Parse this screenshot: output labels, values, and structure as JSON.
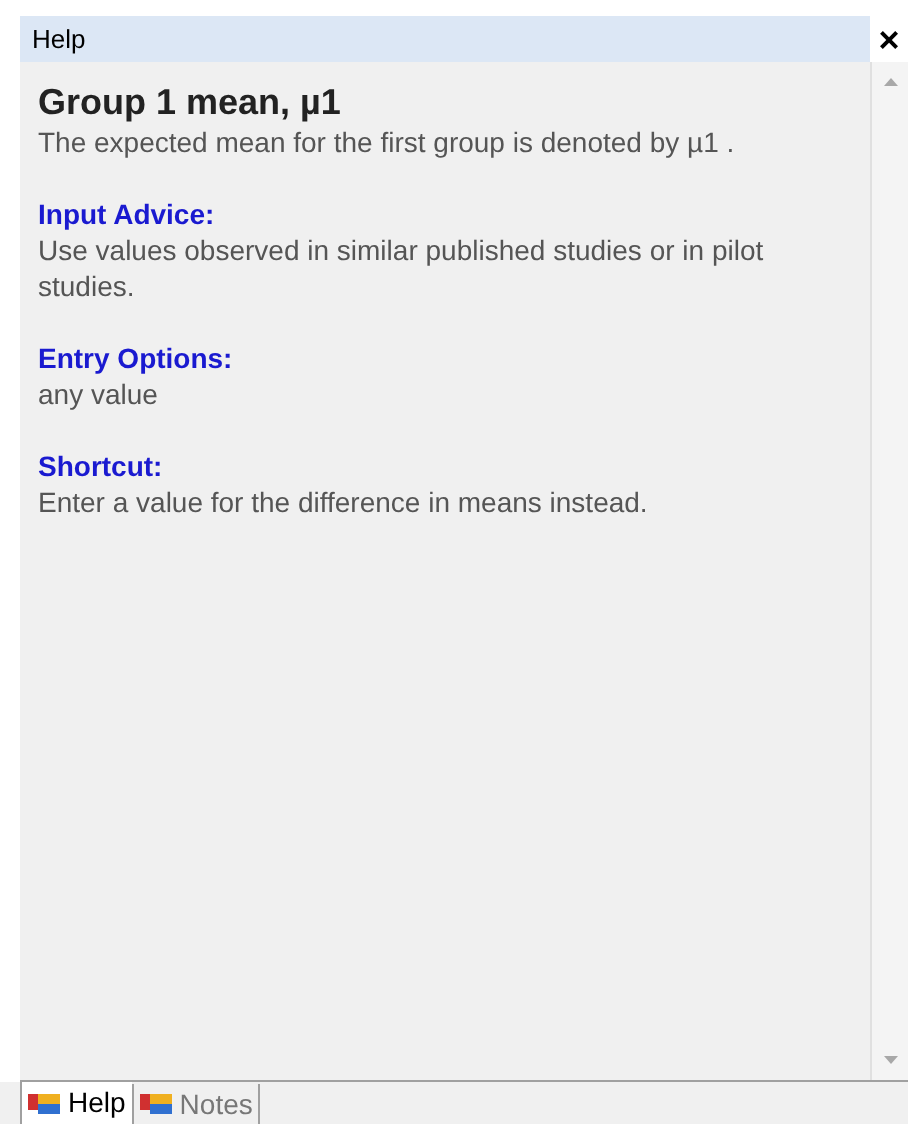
{
  "window": {
    "title": "Help",
    "close": "×"
  },
  "heading": "Group 1 mean, µ1",
  "description": "The expected mean for the first group is denoted by µ1 .",
  "sections": [
    {
      "title": "Input Advice:",
      "body": "Use values observed in similar published studies or in pilot studies."
    },
    {
      "title": "Entry Options:",
      "body": "any value"
    },
    {
      "title": "Shortcut:",
      "body": "Enter a value for the difference in means instead."
    }
  ],
  "tabs": [
    {
      "label": "Help",
      "selected": true
    },
    {
      "label": "Notes",
      "selected": false
    }
  ]
}
